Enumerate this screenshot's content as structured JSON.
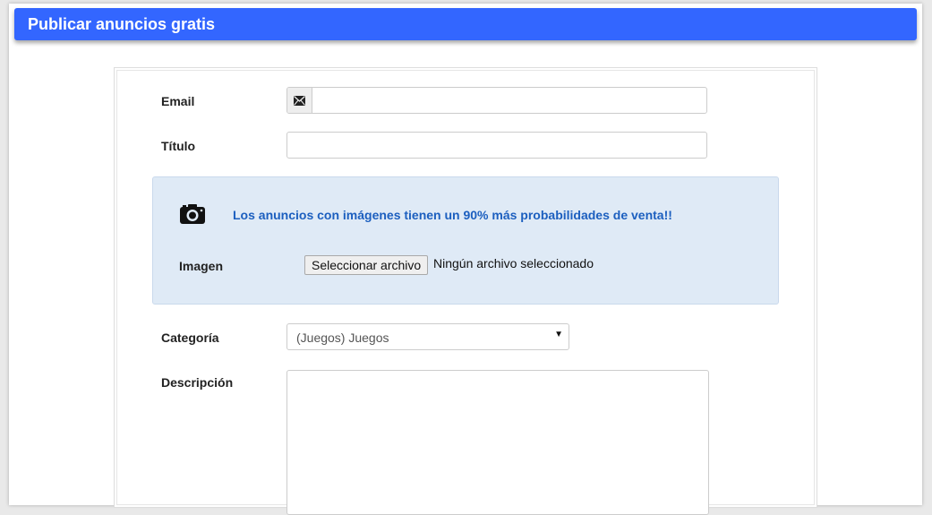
{
  "header": {
    "title": "Publicar anuncios gratis"
  },
  "form": {
    "email_label": "Email",
    "email_value": "",
    "titulo_label": "Título",
    "titulo_value": "",
    "image_box": {
      "promo_text": "Los anuncios con imágenes tienen un 90% más probabilidades de venta!!",
      "image_label": "Imagen",
      "file_button_label": "Seleccionar archivo",
      "file_status": "Ningún archivo seleccionado"
    },
    "categoria_label": "Categoría",
    "categoria_selected": "(Juegos) Juegos",
    "descripcion_label": "Descripción",
    "descripcion_value": ""
  },
  "icons": {
    "email": "envelope-icon",
    "image": "camera-icon",
    "select": "caret-down-icon"
  },
  "colors": {
    "header_bg": "#3366ff",
    "info_box_bg": "#dfeaf6",
    "info_text": "#1c5fbf"
  }
}
